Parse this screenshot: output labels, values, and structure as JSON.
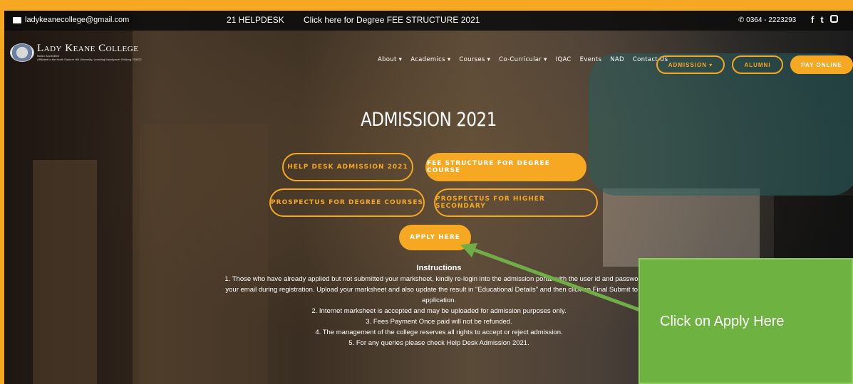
{
  "topbar": {
    "email": "ladykeanecollege@gmail.com",
    "helpdesk": "21 HELPDESK",
    "fee_link": "Click here for Degree FEE STRUCTURE 2021",
    "phone": "0364 - 2223293"
  },
  "logo": {
    "title": "Lady Keane College",
    "subtitle_line1": "NAAC Accredited",
    "subtitle_line2": "Affiliated to the North Eastern Hill University, Umshing Mawkynroh Shillong 793022"
  },
  "nav": {
    "items": [
      "About ▾",
      "Academics ▾",
      "Courses ▾",
      "Co-Curricular ▾",
      "IQAC",
      "Events",
      "NAD",
      "Contact Us"
    ],
    "admission": "ADMISSION ▾",
    "alumni": "ALUMNI",
    "pay_online": "PAY ONLINE"
  },
  "hero": {
    "title": "ADMISSION 2021"
  },
  "buttons": {
    "helpdesk": "HELP DESK ADMISSION 2021",
    "fee_structure": "FEE STRUCTURE FOR DEGREE COURSE",
    "prospectus_degree": "PROSPECTUS FOR DEGREE COURSES",
    "prospectus_hs": "PROSPECTUS FOR HIGHER SECONDARY",
    "apply": "APPLY HERE"
  },
  "instructions": {
    "title": "Instructions",
    "line1": "1. Those who have already applied but not submitted your marksheet, kindly re-login into the admission portal with the user id and password se",
    "line2": "your email during registration. Upload your marksheet and also update the result in \"Educational Details\" and then click on Final Submit to com",
    "line3": "application.",
    "line4": "2. Internet marksheet is accepted and may be uploaded for admission purposes only.",
    "line5": "3. Fees Payment Once paid will not be refunded.",
    "line6": "4. The management of the college reserves all rights to accept or reject admission.",
    "line7": "5. For any queries please check Help Desk Admission 2021."
  },
  "callout": {
    "text": "Click on Apply Here"
  },
  "colors": {
    "accent": "#f7a823",
    "callout": "#6eb342",
    "arrow": "#70ad47"
  },
  "icons": {
    "email": "envelope-icon",
    "phone": "phone-icon",
    "social": [
      "facebook-icon",
      "twitter-icon",
      "instagram-icon"
    ]
  }
}
